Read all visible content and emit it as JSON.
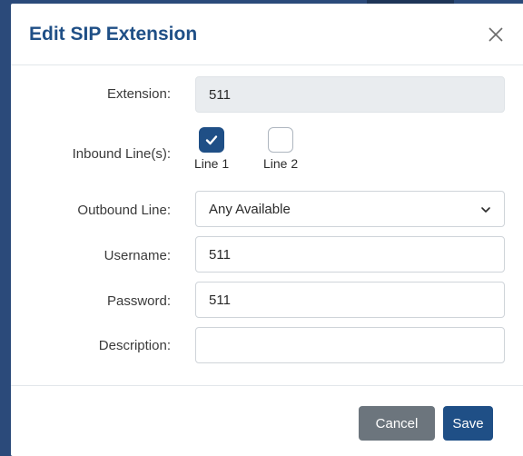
{
  "dialog": {
    "title": "Edit SIP Extension",
    "close_icon": "close-icon"
  },
  "form": {
    "extension": {
      "label": "Extension:",
      "value": "511"
    },
    "inbound": {
      "label": "Inbound Line(s):",
      "lines": [
        {
          "label": "Line 1",
          "checked": true
        },
        {
          "label": "Line 2",
          "checked": false
        }
      ]
    },
    "outbound": {
      "label": "Outbound Line:",
      "value": "Any Available",
      "icon": "chevron-down-icon"
    },
    "username": {
      "label": "Username:",
      "value": "511"
    },
    "password": {
      "label": "Password:",
      "value": "511"
    },
    "description": {
      "label": "Description:",
      "value": ""
    }
  },
  "footer": {
    "cancel_label": "Cancel",
    "save_label": "Save"
  },
  "colors": {
    "primary": "#1f4f86",
    "secondary": "#6c757d",
    "backdrop": "#2b4a7a"
  }
}
